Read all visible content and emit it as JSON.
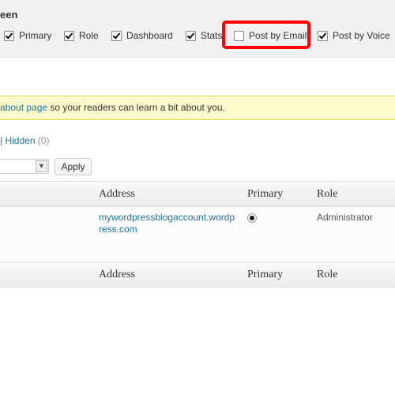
{
  "screen_options": {
    "title": "een",
    "columns": [
      {
        "label": "Primary",
        "checked": true
      },
      {
        "label": "Role",
        "checked": true
      },
      {
        "label": "Dashboard",
        "checked": true
      },
      {
        "label": "Stats",
        "checked": true
      },
      {
        "label": "Post by Email",
        "checked": false
      },
      {
        "label": "Post by Voice",
        "checked": true
      }
    ],
    "highlight_color": "#ff0000"
  },
  "notice": {
    "link": "about page",
    "text": " so your readers can learn a bit about you."
  },
  "filter": {
    "separator": "|",
    "label": "Hidden",
    "count": "(0)"
  },
  "bulk": {
    "apply_label": "Apply"
  },
  "table": {
    "headers": [
      "Address",
      "Primary",
      "Role"
    ],
    "rows": [
      {
        "address": "mywordpressblogaccount.wordpress.com",
        "primary": true,
        "role": "Administrator"
      }
    ]
  }
}
